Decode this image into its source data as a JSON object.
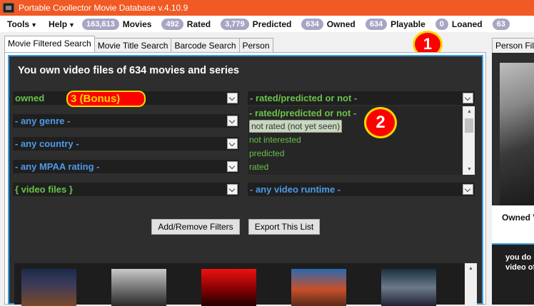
{
  "window": {
    "title": "Portable Coollector Movie Database  v.4.10.9"
  },
  "menu": {
    "tools": "Tools",
    "help": "Help"
  },
  "stats": [
    {
      "count": "163,613",
      "label": "Movies"
    },
    {
      "count": "492",
      "label": "Rated"
    },
    {
      "count": "3,779",
      "label": "Predicted"
    },
    {
      "count": "634",
      "label": "Owned"
    },
    {
      "count": "634",
      "label": "Playable"
    },
    {
      "count": "0",
      "label": "Loaned"
    },
    {
      "count": "63",
      "label": ""
    }
  ],
  "tabs": [
    "Movie Filtered Search",
    "Movie Title Search",
    "Barcode Search",
    "Person"
  ],
  "right_tab": "Person Filt",
  "panel": {
    "headline": "You own video files of 634 movies and series",
    "filters_left": [
      "owned",
      "- any genre -",
      "- any country -",
      "- any MPAA rating -",
      "{ video files }"
    ],
    "filter_right_top": "- rated/predicted or not -",
    "filter_right_bottom": "- any video runtime -",
    "list_options": [
      "- rated/predicted or not -",
      "not rated (not yet seen)",
      "not interested",
      "predicted",
      "rated"
    ],
    "buttons": {
      "add_remove": "Add/Remove Filters",
      "export": "Export This List"
    }
  },
  "annotations": {
    "callout_1": "1",
    "callout_2": "2",
    "bonus": "3 (Bonus)"
  },
  "right_panel": {
    "owned_label": "Owned V",
    "text1": "you do",
    "text2": "video of"
  },
  "colors": {
    "titlebar": "#f15a24",
    "panel_bg": "#2e2e2e",
    "green_text": "#6bc24a",
    "blue_text": "#4c9be6",
    "pill": "#a6a6c4",
    "accent_border": "#3a9ee0",
    "callout_red": "#ff0000",
    "callout_yellow": "#f5d800"
  }
}
